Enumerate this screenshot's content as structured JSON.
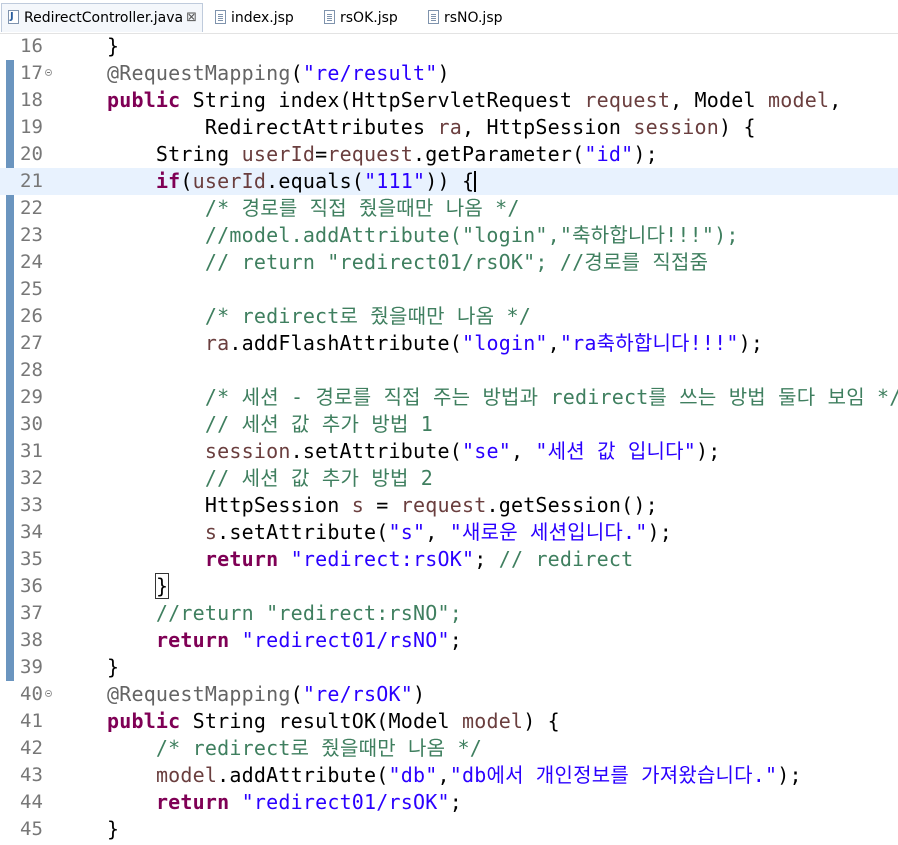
{
  "tabs": [
    {
      "label": "RedirectController.java",
      "icon": "java-file-icon",
      "active": true,
      "closable": true
    },
    {
      "label": "index.jsp",
      "icon": "jsp-file-icon",
      "active": false
    },
    {
      "label": "rsOK.jsp",
      "icon": "jsp-file-icon",
      "active": false
    },
    {
      "label": "rsNO.jsp",
      "icon": "jsp-file-icon",
      "active": false
    }
  ],
  "close_glyph": "⊠",
  "current_line": 21,
  "colors": {
    "keyword": "#7f0055",
    "string": "#2a00ff",
    "comment": "#3f7f5f",
    "annotation": "#646464",
    "variable": "#6a3e3e",
    "current_line_bg": "#e8f2fe",
    "change_marker": "#6b95bf"
  },
  "lines": [
    {
      "n": 16,
      "seg": [
        [
          "",
          "    }"
        ]
      ]
    },
    {
      "n": 17,
      "fold": true,
      "seg": [
        [
          "",
          "    "
        ],
        [
          "ann",
          "@RequestMapping"
        ],
        [
          "",
          "("
        ],
        [
          "str",
          "\"re/result\""
        ],
        [
          "",
          ")"
        ]
      ]
    },
    {
      "n": 18,
      "seg": [
        [
          "",
          "    "
        ],
        [
          "kw",
          "public"
        ],
        [
          "",
          " String index(HttpServletRequest "
        ],
        [
          "var",
          "request"
        ],
        [
          "",
          ", Model "
        ],
        [
          "var",
          "model"
        ],
        [
          "",
          ","
        ]
      ]
    },
    {
      "n": 19,
      "seg": [
        [
          "",
          "            RedirectAttributes "
        ],
        [
          "var",
          "ra"
        ],
        [
          "",
          ", HttpSession "
        ],
        [
          "var",
          "session"
        ],
        [
          "",
          ") {"
        ]
      ]
    },
    {
      "n": 20,
      "seg": [
        [
          "",
          "        String "
        ],
        [
          "var",
          "userId"
        ],
        [
          "",
          "="
        ],
        [
          "var",
          "request"
        ],
        [
          "",
          ".getParameter("
        ],
        [
          "str",
          "\"id\""
        ],
        [
          "",
          ");"
        ]
      ]
    },
    {
      "n": 21,
      "seg": [
        [
          "",
          "        "
        ],
        [
          "kw",
          "if"
        ],
        [
          "",
          "("
        ],
        [
          "var",
          "userId"
        ],
        [
          "",
          ".equals("
        ],
        [
          "str",
          "\"111\""
        ],
        [
          "",
          ")) {"
        ],
        [
          "caret",
          ""
        ]
      ]
    },
    {
      "n": 22,
      "seg": [
        [
          "cm",
          "            /* 경로를 직접 줬을때만 나옴 */"
        ]
      ]
    },
    {
      "n": 23,
      "seg": [
        [
          "cm",
          "            //model.addAttribute(\"login\",\"축하합니다!!!\");"
        ]
      ]
    },
    {
      "n": 24,
      "seg": [
        [
          "cm",
          "            // return \"redirect01/rsOK\"; //경로를 직접줌"
        ]
      ]
    },
    {
      "n": 25,
      "seg": [
        [
          "",
          ""
        ]
      ]
    },
    {
      "n": 26,
      "seg": [
        [
          "cm",
          "            /* redirect로 줬을때만 나옴 */"
        ]
      ]
    },
    {
      "n": 27,
      "seg": [
        [
          "",
          "            "
        ],
        [
          "var",
          "ra"
        ],
        [
          "",
          ".addFlashAttribute("
        ],
        [
          "str",
          "\"login\""
        ],
        [
          "",
          ","
        ],
        [
          "str",
          "\"ra축하합니다!!!\""
        ],
        [
          "",
          ");"
        ]
      ]
    },
    {
      "n": 28,
      "seg": [
        [
          "",
          ""
        ]
      ]
    },
    {
      "n": 29,
      "seg": [
        [
          "cm",
          "            /* 세션 - 경로를 직접 주는 방법과 redirect를 쓰는 방법 둘다 보임 */"
        ]
      ]
    },
    {
      "n": 30,
      "seg": [
        [
          "cm",
          "            // 세션 값 추가 방법 1"
        ]
      ]
    },
    {
      "n": 31,
      "seg": [
        [
          "",
          "            "
        ],
        [
          "var",
          "session"
        ],
        [
          "",
          ".setAttribute("
        ],
        [
          "str",
          "\"se\""
        ],
        [
          "",
          ", "
        ],
        [
          "str",
          "\"세션 값 입니다\""
        ],
        [
          "",
          ");"
        ]
      ]
    },
    {
      "n": 32,
      "seg": [
        [
          "cm",
          "            // 세션 값 추가 방법 2"
        ]
      ]
    },
    {
      "n": 33,
      "seg": [
        [
          "",
          "            HttpSession "
        ],
        [
          "var",
          "s"
        ],
        [
          "",
          " = "
        ],
        [
          "var",
          "request"
        ],
        [
          "",
          ".getSession();"
        ]
      ]
    },
    {
      "n": 34,
      "seg": [
        [
          "",
          "            "
        ],
        [
          "var",
          "s"
        ],
        [
          "",
          ".setAttribute("
        ],
        [
          "str",
          "\"s\""
        ],
        [
          "",
          ", "
        ],
        [
          "str",
          "\"새로운 세션입니다.\""
        ],
        [
          "",
          ");"
        ]
      ]
    },
    {
      "n": 35,
      "seg": [
        [
          "",
          "            "
        ],
        [
          "kw",
          "return"
        ],
        [
          "",
          " "
        ],
        [
          "str",
          "\"redirect:rsOK\""
        ],
        [
          "",
          "; "
        ],
        [
          "cm",
          "// redirect"
        ]
      ]
    },
    {
      "n": 36,
      "seg": [
        [
          "",
          "        "
        ],
        [
          "box",
          "}"
        ]
      ]
    },
    {
      "n": 37,
      "seg": [
        [
          "cm",
          "        //return \"redirect:rsNO\";"
        ]
      ]
    },
    {
      "n": 38,
      "seg": [
        [
          "",
          "        "
        ],
        [
          "kw",
          "return"
        ],
        [
          "",
          " "
        ],
        [
          "str",
          "\"redirect01/rsNO\""
        ],
        [
          "",
          ";"
        ]
      ]
    },
    {
      "n": 39,
      "seg": [
        [
          "",
          "    }"
        ]
      ]
    },
    {
      "n": 40,
      "fold": true,
      "seg": [
        [
          "",
          "    "
        ],
        [
          "ann",
          "@RequestMapping"
        ],
        [
          "",
          "("
        ],
        [
          "str",
          "\"re/rsOK\""
        ],
        [
          "",
          ")"
        ]
      ]
    },
    {
      "n": 41,
      "seg": [
        [
          "",
          "    "
        ],
        [
          "kw",
          "public"
        ],
        [
          "",
          " String resultOK(Model "
        ],
        [
          "var",
          "model"
        ],
        [
          "",
          ") {"
        ]
      ]
    },
    {
      "n": 42,
      "seg": [
        [
          "cm",
          "        /* redirect로 줬을때만 나옴 */"
        ]
      ]
    },
    {
      "n": 43,
      "seg": [
        [
          "",
          "        "
        ],
        [
          "var",
          "model"
        ],
        [
          "",
          ".addAttribute("
        ],
        [
          "str",
          "\"db\""
        ],
        [
          "",
          ","
        ],
        [
          "str",
          "\"db에서 개인정보를 가져왔습니다.\""
        ],
        [
          "",
          ");"
        ]
      ]
    },
    {
      "n": 44,
      "seg": [
        [
          "",
          "        "
        ],
        [
          "kw",
          "return"
        ],
        [
          "",
          " "
        ],
        [
          "str",
          "\"redirect01/rsOK\""
        ],
        [
          "",
          ";"
        ]
      ]
    },
    {
      "n": 45,
      "seg": [
        [
          "",
          "    }"
        ]
      ]
    }
  ]
}
